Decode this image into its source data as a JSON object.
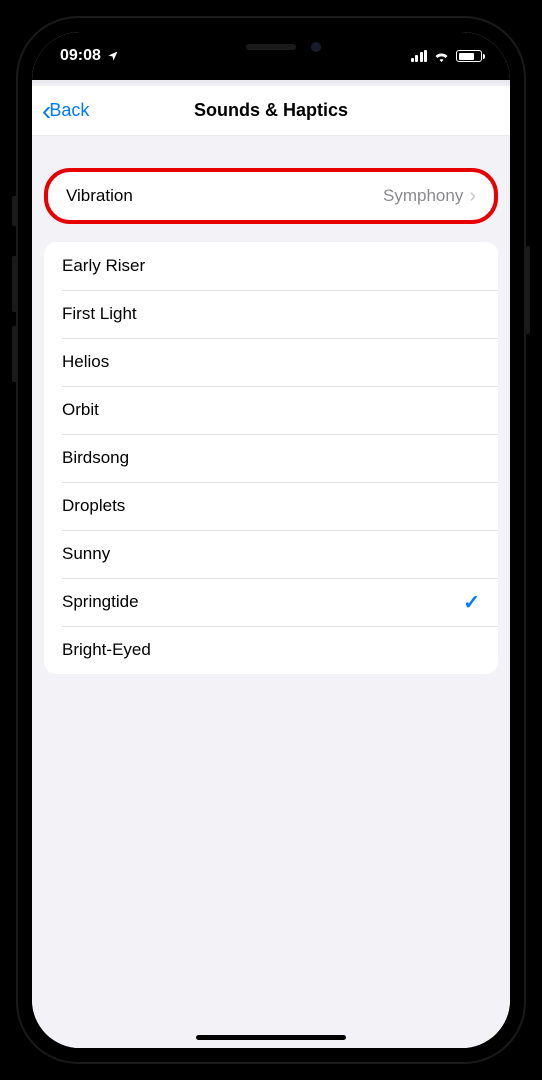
{
  "status": {
    "time": "09:08",
    "location_arrow": "➤"
  },
  "nav": {
    "back_label": "Back",
    "title": "Sounds & Haptics"
  },
  "vibration": {
    "label": "Vibration",
    "value": "Symphony"
  },
  "sounds": [
    {
      "label": "Early Riser",
      "selected": false
    },
    {
      "label": "First Light",
      "selected": false
    },
    {
      "label": "Helios",
      "selected": false
    },
    {
      "label": "Orbit",
      "selected": false
    },
    {
      "label": "Birdsong",
      "selected": false
    },
    {
      "label": "Droplets",
      "selected": false
    },
    {
      "label": "Sunny",
      "selected": false
    },
    {
      "label": "Springtide",
      "selected": true
    },
    {
      "label": "Bright-Eyed",
      "selected": false
    }
  ]
}
